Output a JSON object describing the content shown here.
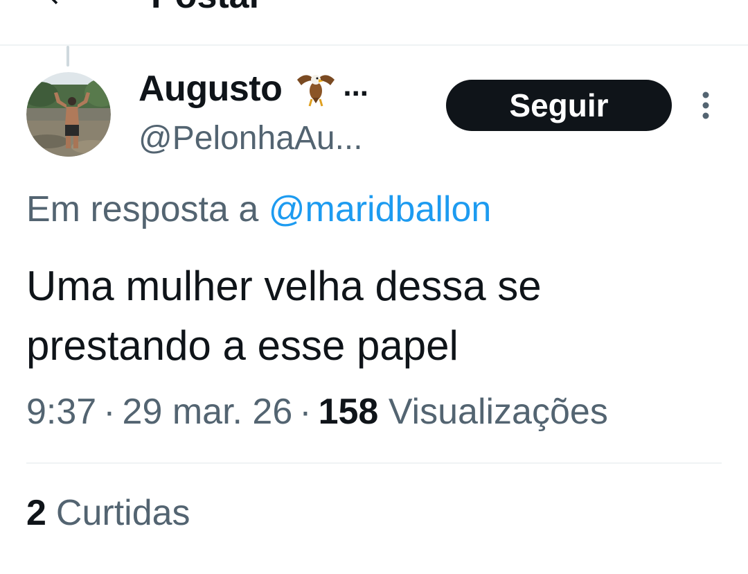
{
  "header": {
    "title": "Postar",
    "back_icon": "arrow-left-icon"
  },
  "author": {
    "display_name": "Augusto",
    "name_emoji": "eagle-emoji",
    "name_ellipsis": "...",
    "handle": "@PelonhaAu..."
  },
  "follow_label": "Seguir",
  "more_icon": "more-vertical-icon",
  "reply": {
    "prefix": "Em resposta a",
    "mention": "@maridballon"
  },
  "tweet": {
    "text": "Uma mulher velha dessa se prestando a esse papel"
  },
  "meta": {
    "time": "9:37",
    "separator": "·",
    "date": "29 mar. 26",
    "views_count": "158",
    "views_label": "Visualizações"
  },
  "likes": {
    "count": "2",
    "label": "Curtidas"
  },
  "colors": {
    "text": "#0f1419",
    "secondary": "#536471",
    "link": "#1d9bf0",
    "button_bg": "#0f1419",
    "divider": "#eff3f4"
  }
}
